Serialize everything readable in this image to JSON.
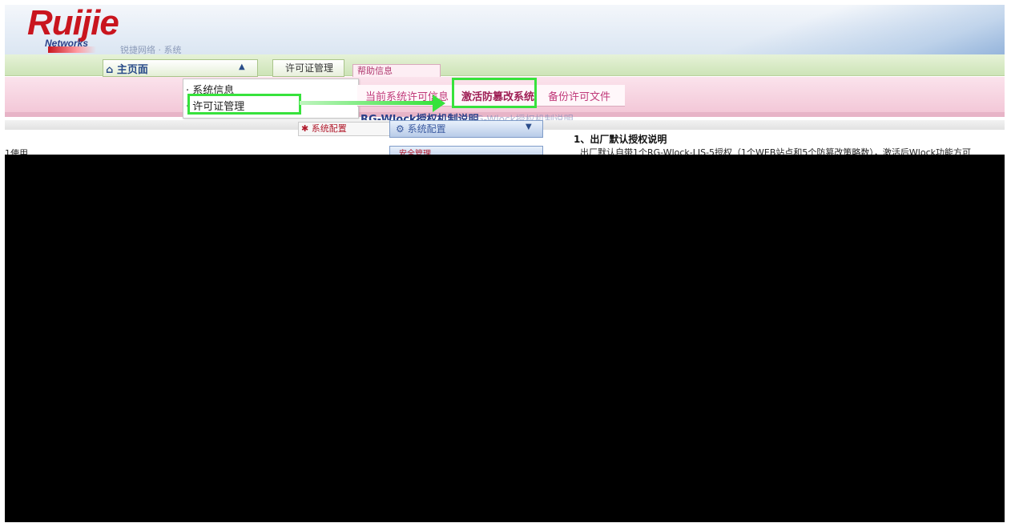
{
  "brand": {
    "logo_text": "Ruijie",
    "logo_sub": "Networks"
  },
  "header": {
    "title_fragment": "锐捷网络 · 系统"
  },
  "nav": {
    "home_label": "主页面",
    "home_arrow": "▲",
    "license_tab_label": "许可证管理",
    "top_tab_label": "帮助信息"
  },
  "menu": {
    "items": [
      {
        "label": "· 系统信息"
      },
      {
        "label": "· 许可证管理"
      }
    ]
  },
  "tabs": [
    {
      "label": "当前系统许可信息"
    },
    {
      "label": "激活防篡改系统"
    },
    {
      "label": "备份许可文件"
    }
  ],
  "section": {
    "title": "RG-Wlock授权机制说明",
    "title_ghost": "RG-Wlock授权机制说明"
  },
  "sidebar": {
    "system_mgmt_label": "系统配置",
    "dropdown1_label": "系统配置",
    "dropdown1_arrow": "▼",
    "dropdown2_label": "安全管理"
  },
  "content": {
    "heading": "1、出厂默认授权说明",
    "line1": "出厂默认自带1个RG-Wlock-LIS-5授权（1个WEB站点和5个防篡改策略数），激活后Wlock功能方可"
  },
  "left_fragment": "1使用"
}
